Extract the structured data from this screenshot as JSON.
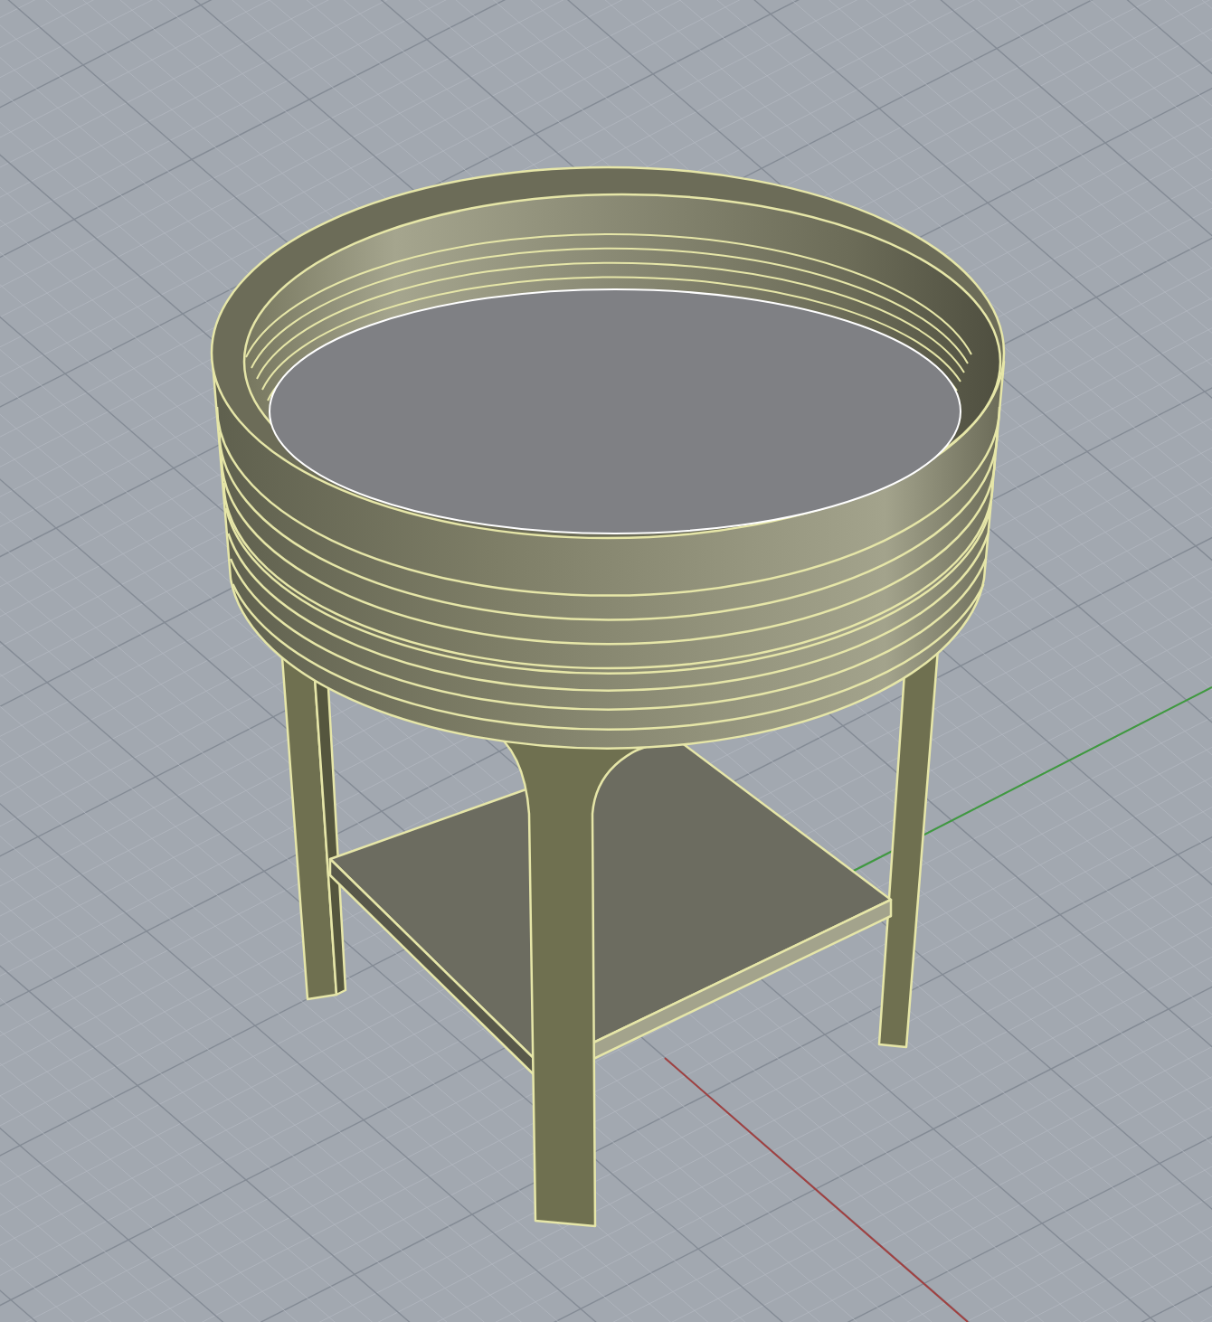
{
  "viewport": {
    "kind": "perspective",
    "show_grid": true,
    "show_axes": true
  }
}
